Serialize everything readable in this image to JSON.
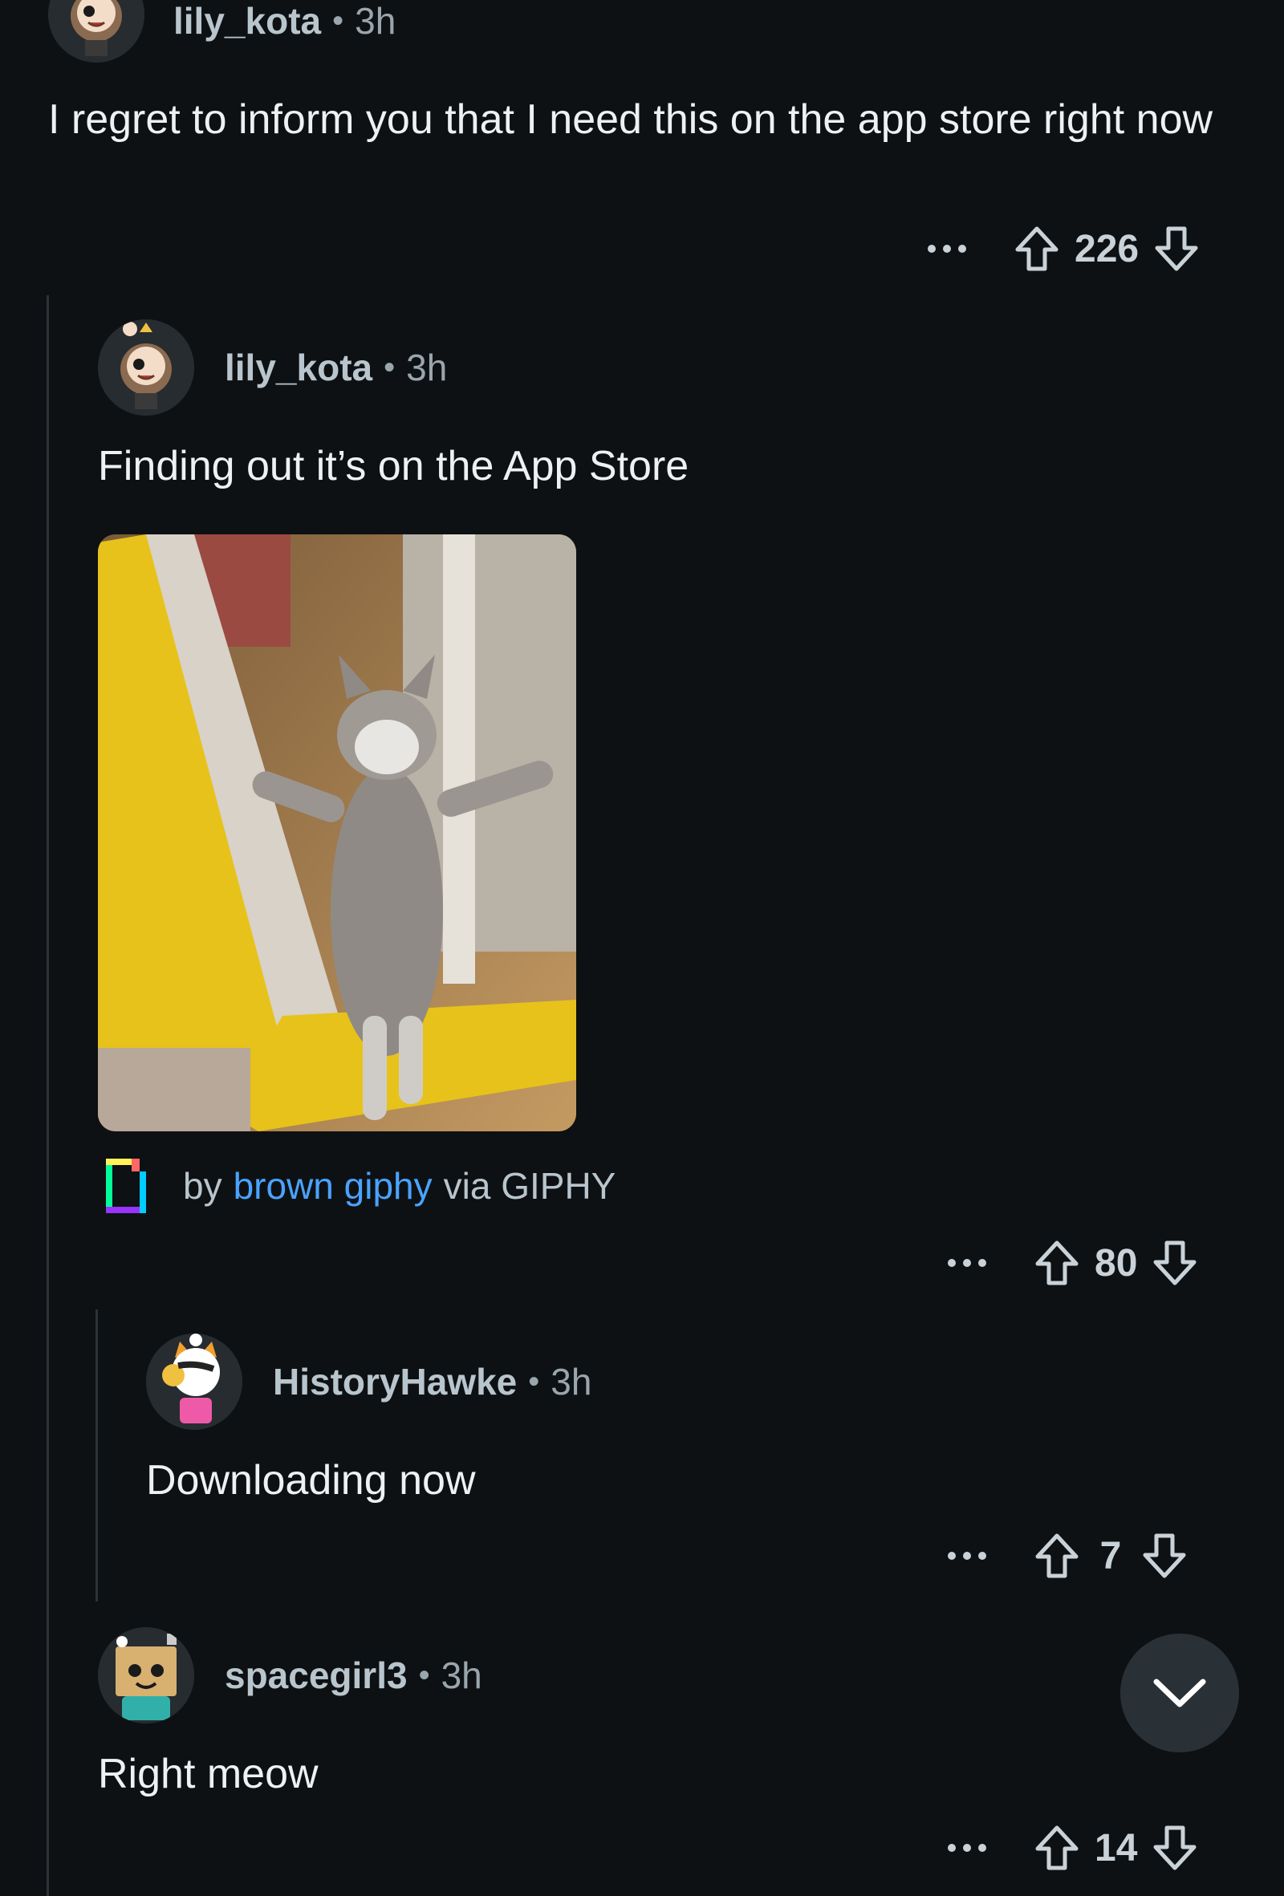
{
  "comments": [
    {
      "username": "lily_kota",
      "time": "3h",
      "text": "I regret to inform you that I need this on the app store right now",
      "score": "226"
    },
    {
      "username": "lily_kota",
      "time": "3h",
      "text": "Finding out it’s on the App Store",
      "score": "80",
      "attribution": {
        "by": "by",
        "author": "brown giphy",
        "via": "via GIPHY"
      }
    },
    {
      "username": "HistoryHawke",
      "time": "3h",
      "text": "Downloading now",
      "score": "7"
    },
    {
      "username": "spacegirl3",
      "time": "3h",
      "text": "Right meow",
      "score": "14"
    }
  ],
  "separator": "•",
  "colors": {
    "background": "#0e1113",
    "link": "#4aa3ff",
    "username": "#b8c5cd"
  },
  "icons": [
    "more-icon",
    "upvote-icon",
    "downvote-icon",
    "giphy-icon",
    "chevron-down-icon"
  ]
}
